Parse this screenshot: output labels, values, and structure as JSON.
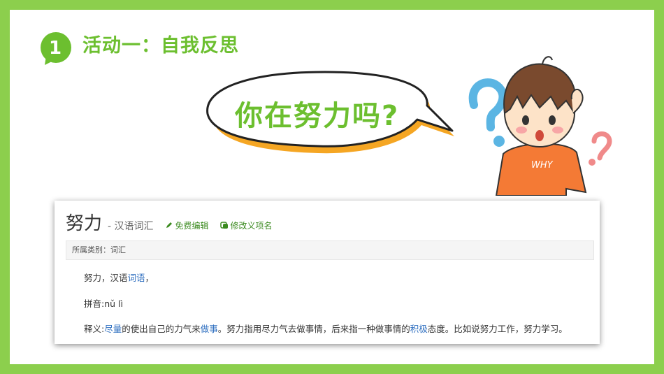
{
  "section": {
    "number": "1",
    "title": "活动一：自我反思"
  },
  "bubble": {
    "text": "你在努力吗?"
  },
  "character": {
    "shirt_text": "WHY"
  },
  "entry": {
    "word": "努力",
    "subtitle": "- 汉语词汇",
    "edit_label": "免费编辑",
    "rename_label": "修改义项名",
    "category": "所属类别：词汇",
    "line1": {
      "prefix": "努力，汉语",
      "link": "词语",
      "suffix": "，"
    },
    "line2": {
      "text": "拼音:nǔ lì"
    },
    "line3": {
      "prefix": "释义:",
      "link1": "尽量",
      "mid1": "的使出自己的力气来",
      "link2": "做事",
      "mid2": "。努力指用尽力气去做事情，后来指一种做事情的",
      "link3": "积极",
      "suffix": "态度。比如说努力工作，努力学习。"
    }
  },
  "colors": {
    "border": "#8ccf4d",
    "accent": "#6cbf2f",
    "shirt": "#f47a35",
    "link": "#2f6fc0"
  }
}
